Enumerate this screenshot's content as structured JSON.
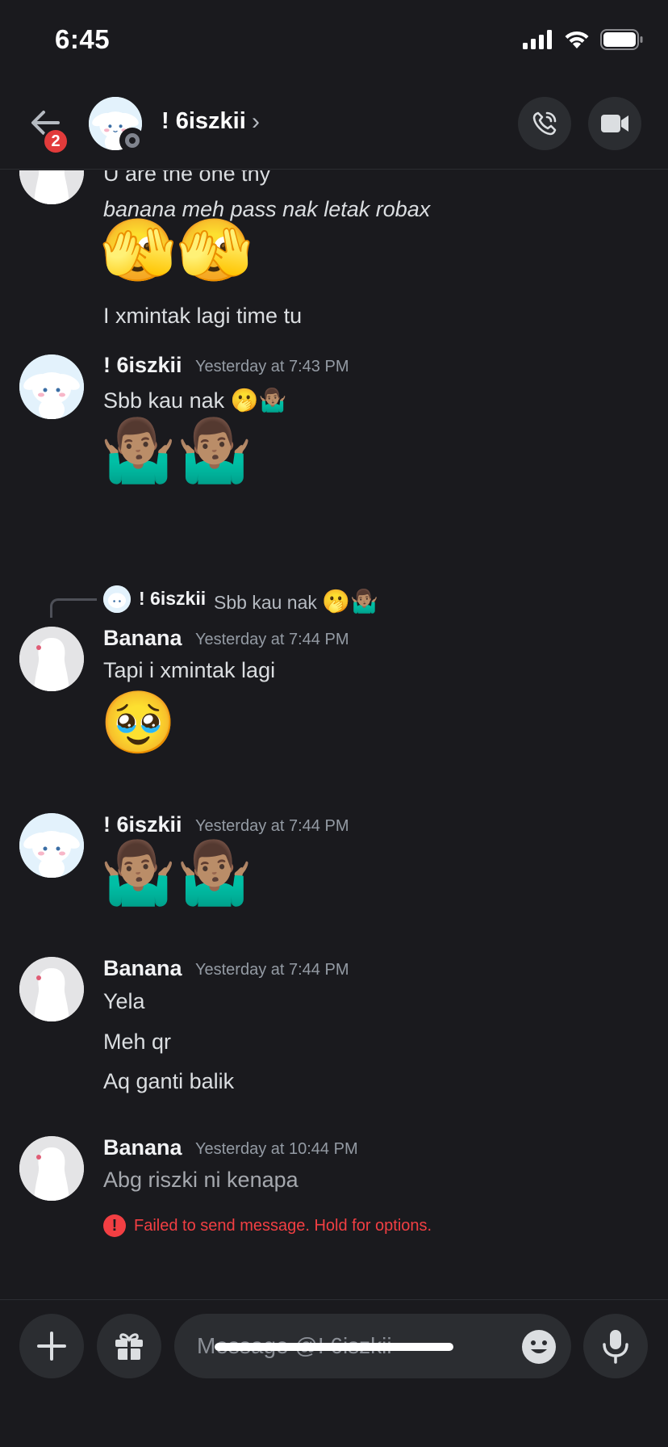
{
  "status": {
    "time": "6:45"
  },
  "header": {
    "title": "! 6iszkii",
    "chevron": "›",
    "badge_count": "2",
    "icons": [
      "back-arrow-icon",
      "phone-call-icon",
      "video-camera-icon"
    ]
  },
  "messages": {
    "first_group": {
      "lines": [
        "U are the one tny",
        "banana meh pass nak letak robax",
        "I xmintak lagi time tu"
      ],
      "emoji": "🫣🫣"
    },
    "m2": {
      "author": "! 6iszkii",
      "time": "Yesterday at 7:43 PM",
      "text": "Sbb kau nak",
      "inline_emoji": "🫢🤷🏽‍♂️",
      "emoji": "🤷🏽‍♂️🤷🏽‍♂️"
    },
    "reply": {
      "author": "! 6iszkii",
      "text": "Sbb kau nak",
      "emoji": "🫢🤷🏽‍♂️"
    },
    "m3": {
      "author": "Banana",
      "time": "Yesterday at 7:44 PM",
      "text": "Tapi i xmintak lagi",
      "emoji": "🥹"
    },
    "m4": {
      "author": "! 6iszkii",
      "time": "Yesterday at 7:44 PM",
      "emoji": "🤷🏽‍♂️🤷🏽‍♂️"
    },
    "m5": {
      "author": "Banana",
      "time": "Yesterday at 7:44 PM",
      "lines": [
        "Yela",
        "Meh qr",
        "Aq ganti balik"
      ]
    },
    "m6": {
      "author": "Banana",
      "time": "Yesterday at 10:44 PM",
      "text": "Abg riszki ni kenapa",
      "error": "Failed to send message. Hold for options."
    }
  },
  "composer": {
    "placeholder": "Message @! 6iszkii",
    "icons": [
      "plus-icon",
      "gift-icon",
      "emoji-icon",
      "microphone-icon"
    ]
  },
  "colors": {
    "background": "#1a1a1e",
    "surface": "#2b2d31",
    "error": "#f23f43",
    "badge": "#e23b3b"
  }
}
